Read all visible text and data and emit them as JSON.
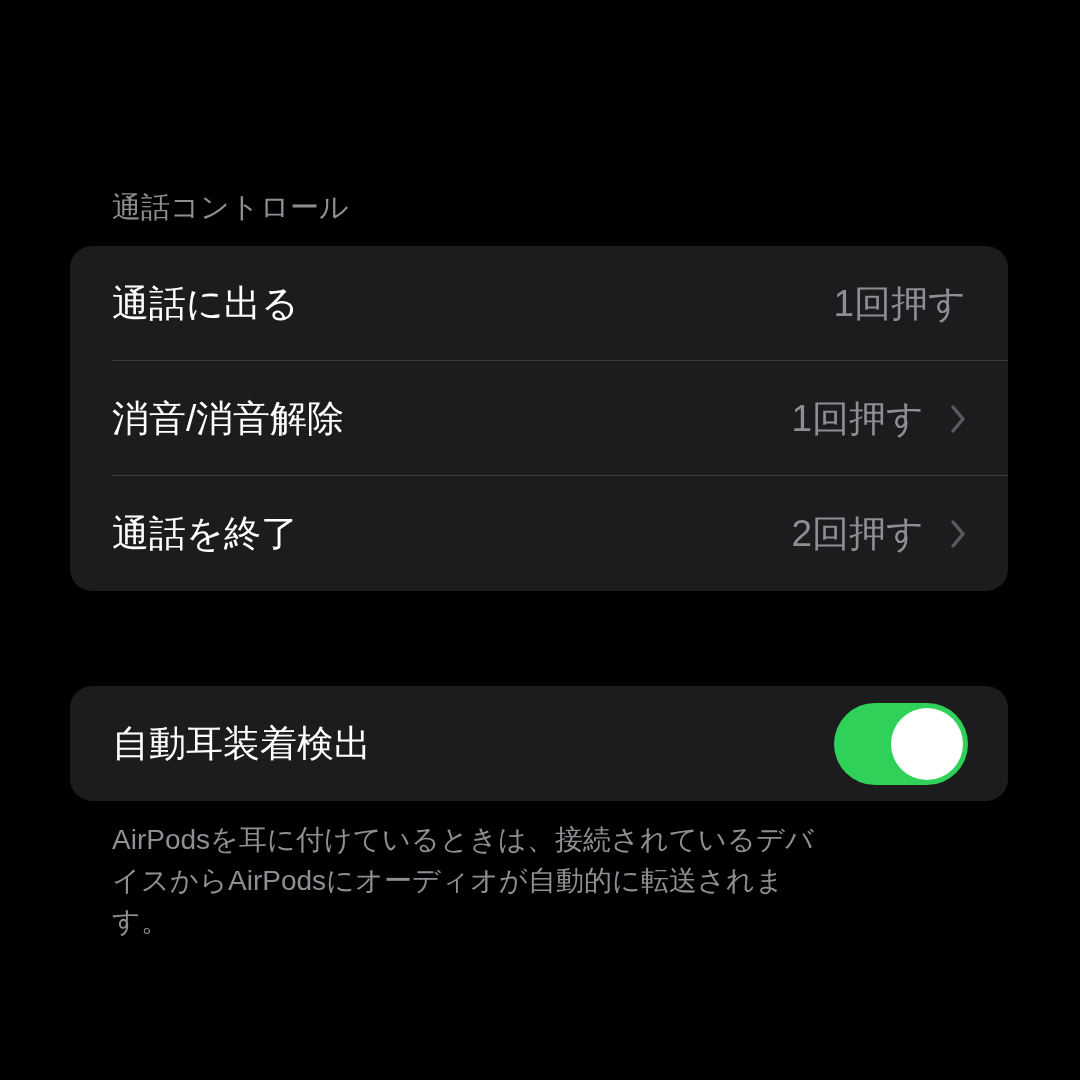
{
  "call_controls": {
    "header": "通話コントロール",
    "rows": [
      {
        "label": "通話に出る",
        "value": "1回押す",
        "chevron": false
      },
      {
        "label": "消音/消音解除",
        "value": "1回押す",
        "chevron": true
      },
      {
        "label": "通話を終了",
        "value": "2回押す",
        "chevron": true
      }
    ]
  },
  "ear_detection": {
    "label": "自動耳装着検出",
    "on": true,
    "footnote": "AirPodsを耳に付けているときは、接続されているデバイスからAirPodsにオーディオが自動的に転送されます。"
  }
}
